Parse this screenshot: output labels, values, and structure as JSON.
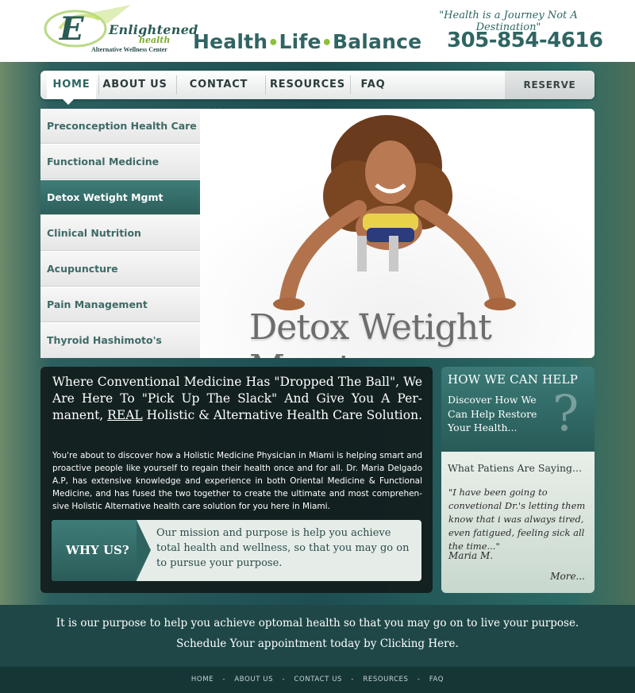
{
  "brand": {
    "name": "Enlightened",
    "sub": "health",
    "center": "Alternative Wellness Center"
  },
  "header": {
    "tagline_parts": [
      "Health",
      "Life",
      "Balance"
    ],
    "quote": "\"Health is a Journey Not A Destination\"",
    "phone": "305-854-4616"
  },
  "nav": {
    "items": [
      "HOME",
      "ABOUT US",
      "CONTACT US",
      "RESOURCES",
      "FAQ"
    ],
    "reserve": "RESERVE ONLINE"
  },
  "side_menu": {
    "items": [
      "Preconception Health Care",
      "Functional Medicine",
      "Detox Wetight Mgmt",
      "Clinical Nutrition",
      "Acupuncture",
      "Pain Management",
      "Thyroid Hashimoto's"
    ],
    "active_index": 2
  },
  "hero": {
    "caption": "Detox Wetight Mgmt"
  },
  "content": {
    "headline_pre": "Where Conventional Medicine Has \"Dropped The Ball\", We Are Here To  \"Pick Up The Slack\" And Give You A Per-manent, ",
    "headline_emph": "REAL",
    "headline_post": " Holistic & Alternative Health Care Solution.",
    "body": "You're about to discover how a Holistic Medicine Physician in Miami is helping smart and proactive people like yourself to regain their health once and for all. Dr. Maria Delgado A.P, has extensive knowledge and experience in both Oriental Medicine & Functional Medicine, and has fused the two together to create the ultimate and most comprehen-sive Holistic Alternative health care solution for you here in Miami."
  },
  "why": {
    "label": "WHY US?",
    "text": "Our mission and purpose is help you achieve total health and wellness, so that you may go on to pursue your purpose."
  },
  "help": {
    "title": "HOW WE CAN HELP",
    "text": "Discover How We Can Help Restore Your Health..."
  },
  "testimonial": {
    "title": "What Patiens Are Saying...",
    "quote": "\"I have been going to convetional Dr.'s letting them know that i was always tired, even fatigued, feeling sick all the time...\"",
    "author": "Maria M.",
    "more": "More..."
  },
  "banner": {
    "line1": "It is our purpose to help you achieve optomal health so that you may go on to live your purpose.",
    "line2": "Schedule Your appointment today by Clicking Here."
  },
  "footer": {
    "links": [
      "HOME",
      "ABOUT US",
      "CONTACT US",
      "RESOURCES",
      "FAQ"
    ],
    "separator": "-"
  },
  "colors": {
    "teal": "#2f6563",
    "accent_green": "#8cbf3a"
  }
}
